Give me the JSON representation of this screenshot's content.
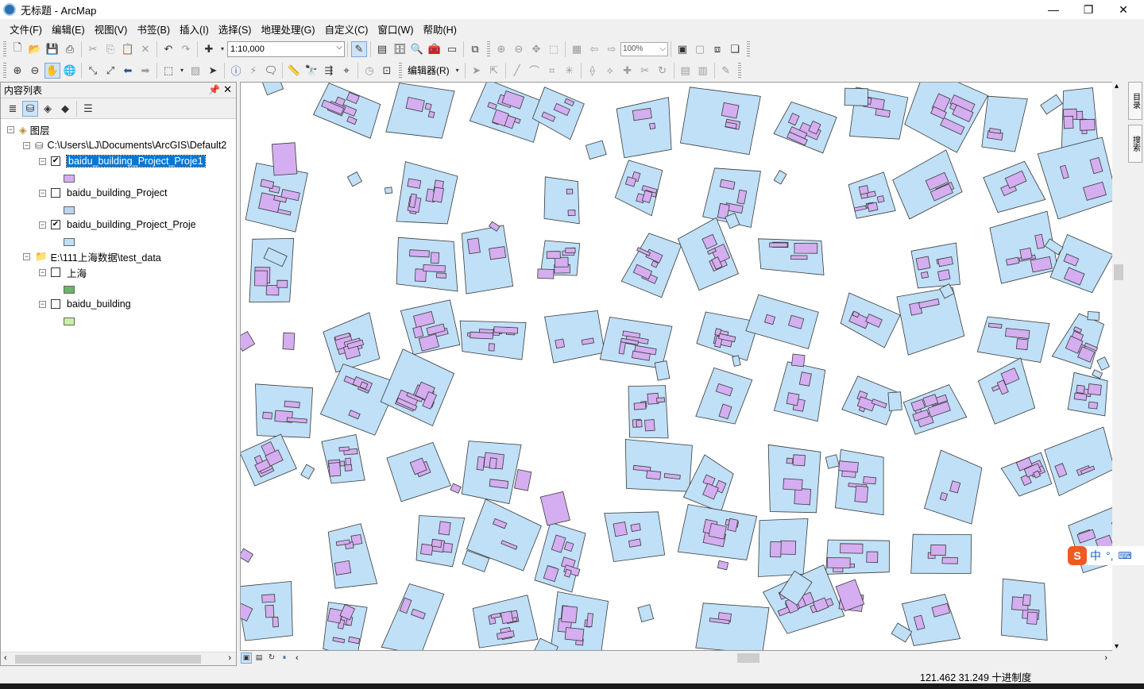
{
  "window": {
    "title": "无标题 - ArcMap",
    "minimize": "—",
    "maximize": "❐",
    "close": "✕"
  },
  "menu": [
    "文件(F)",
    "编辑(E)",
    "视图(V)",
    "书签(B)",
    "插入(I)",
    "选择(S)",
    "地理处理(G)",
    "自定义(C)",
    "窗口(W)",
    "帮助(H)"
  ],
  "toolbar": {
    "scale": "1:10,000",
    "zoom": "100%",
    "editor": "编辑器(R)"
  },
  "toc": {
    "title": "内容列表",
    "layers_root": "图层",
    "items": [
      {
        "label": "C:\\Users\\LJ\\Documents\\ArcGIS\\Default2",
        "kind": "gdb"
      },
      {
        "label": "baidu_building_Project_Proje1",
        "checked": true,
        "selected": true,
        "swatch": "#d4aef0"
      },
      {
        "label": "baidu_building_Project",
        "checked": false,
        "swatch": "#bcd4f0"
      },
      {
        "label": "baidu_building_Project_Proje",
        "checked": true,
        "swatch": "#bfe0f7"
      },
      {
        "label": "E:\\111上海数据\\test_data",
        "kind": "folder"
      },
      {
        "label": "上海",
        "checked": false,
        "swatch": "#6cb36c"
      },
      {
        "label": "baidu_building",
        "checked": false,
        "swatch": "#c8f0a8"
      }
    ]
  },
  "side_tabs": [
    "目录",
    "搜索"
  ],
  "status": {
    "coords": "121.462  31.249 十进制度"
  },
  "ime": {
    "lang": "中",
    "punct": "°,"
  },
  "colors": {
    "parcel_fill": "#bfe0f7",
    "building_fill": "#d4aef0",
    "selection": "#0078d7"
  }
}
